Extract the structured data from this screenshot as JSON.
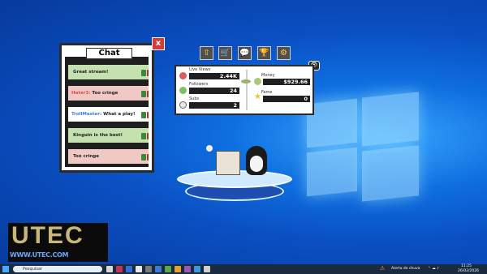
{
  "desktop": {
    "wallpaper": "windows-light-blue"
  },
  "chat": {
    "title": "Chat",
    "close_label": "x",
    "messages": [
      {
        "user": "",
        "text": "Great stream!",
        "bg": "#c5e1b0",
        "user_color": "#d4c04a"
      },
      {
        "user": "Hater3:",
        "text": "Too cringe",
        "bg": "#f0c9c4",
        "user_color": "#e04a4a"
      },
      {
        "user": "TrollMaster:",
        "text": "What a play!",
        "bg": "#ffffff",
        "user_color": "#3a7bdc"
      },
      {
        "user": "",
        "text": "Kinguin is the best!",
        "bg": "#c5e1b0",
        "user_color": "#d4c04a"
      },
      {
        "user": "",
        "text": "Too cringe",
        "bg": "#f0c9c4",
        "user_color": "#6ac86a"
      }
    ]
  },
  "toolbar": {
    "buttons": [
      {
        "name": "upgrade-icon",
        "glyph": "⇧"
      },
      {
        "name": "shop-cart-icon",
        "glyph": "🛒"
      },
      {
        "name": "chat-bubble-icon",
        "glyph": "💬"
      },
      {
        "name": "trophy-icon",
        "glyph": "🏆"
      },
      {
        "name": "settings-icon",
        "glyph": "⚙"
      }
    ],
    "eye_glyph": "👁"
  },
  "stats": {
    "live_views_label": "Live Views",
    "live_views_value": "2.44K",
    "followers_label": "Followers",
    "followers_value": "24",
    "subs_label": "Subs",
    "subs_value": "2",
    "money_label": "Money",
    "money_value": "$929.66",
    "fame_label": "Fame",
    "fame_value": "0"
  },
  "taskbar": {
    "search_placeholder": "Pesquisar",
    "weather_text": "Alerta de chuva",
    "time": "11:25",
    "date": "26/02/2026"
  },
  "logo": {
    "letters": "UTEC",
    "site": "WWW.UTEC.COM"
  },
  "colors": {
    "panel_dark": "#1f1f1f",
    "taskbar": "#1a2a3f",
    "close_red": "#d63a3a"
  }
}
